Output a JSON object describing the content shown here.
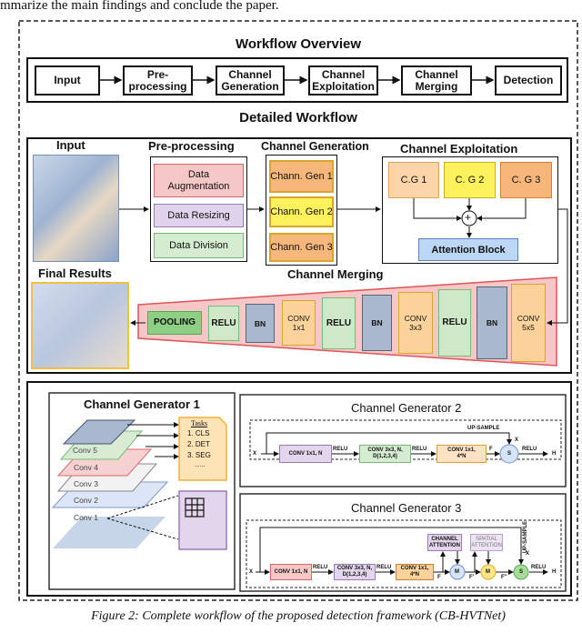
{
  "top_text": "mmarize the main findings and conclude the paper.",
  "overview": {
    "title": "Workflow Overview",
    "steps": [
      "Input",
      "Pre-\nprocessing",
      "Channel\nGeneration",
      "Channel\nExploitation",
      "Channel\nMerging",
      "Detection"
    ]
  },
  "detailed": {
    "title": "Detailed Workflow",
    "input_label": "Input",
    "preprocessing": {
      "label": "Pre-processing",
      "items": [
        "Data\nAugmentation",
        "Data Resizing",
        "Data Division"
      ]
    },
    "channel_generation": {
      "label": "Channel Generation",
      "items": [
        "Chann. Gen 1",
        "Chann. Gen 2",
        "Chann. Gen 3"
      ]
    },
    "channel_exploitation": {
      "label": "Channel Exploitation",
      "items": [
        "C.G 1",
        "C. G 2",
        "C. G 3"
      ],
      "plus": "+",
      "attention": "Attention Block"
    },
    "channel_merging": {
      "label": "Channel Merging",
      "layers": [
        "POOLING",
        "RELU",
        "BN",
        "CONV\n1x1",
        "RELU",
        "BN",
        "CONV\n3x3",
        "RELU",
        "BN",
        "CONV\n5x5"
      ]
    },
    "final_results_label": "Final Results"
  },
  "cg1": {
    "title": "Channel Generator 1",
    "tasks_title": "Tasks",
    "tasks": [
      "1. CLS",
      "2. DET",
      "3. SEG",
      "......"
    ],
    "layers": [
      "Conv 5",
      "Conv 4",
      "Conv 3",
      "Conv 2",
      "Conv 1"
    ]
  },
  "cg2": {
    "title": "Channel Generator 2",
    "x": "X",
    "up": "UP-SAMPLE",
    "x2": "X",
    "b1": "CONV 1x1, N",
    "r1": "RELU",
    "b2": "CONV 3x3, N,\nD(1,2,3,4)",
    "r2": "RELU",
    "b3": "CONV 1x1,\n4*N",
    "f": "F",
    "s": "S",
    "r3": "RELU",
    "h": "H"
  },
  "cg3": {
    "title": "Channel Generator 3",
    "x": "X",
    "b1": "CONV 1x1, N",
    "r1": "RELU",
    "b2": "CONV 3x3, N,\nD(1,2,3,4)",
    "r2": "RELU",
    "b3": "CONV 1x1,\n4*N",
    "ca": "CHANNEL\nATTENTION",
    "sa": "SPATIAL\nATTENTION",
    "up": "UP-SAMPLE",
    "x2": "X",
    "f": "F",
    "f1": "F'",
    "f2": "F''",
    "m1": "M",
    "m2": "M",
    "s": "S",
    "r3": "RELU",
    "h": "H"
  },
  "caption": "Figure 2: Complete workflow of the proposed detection framework (CB-HVTNet)"
}
